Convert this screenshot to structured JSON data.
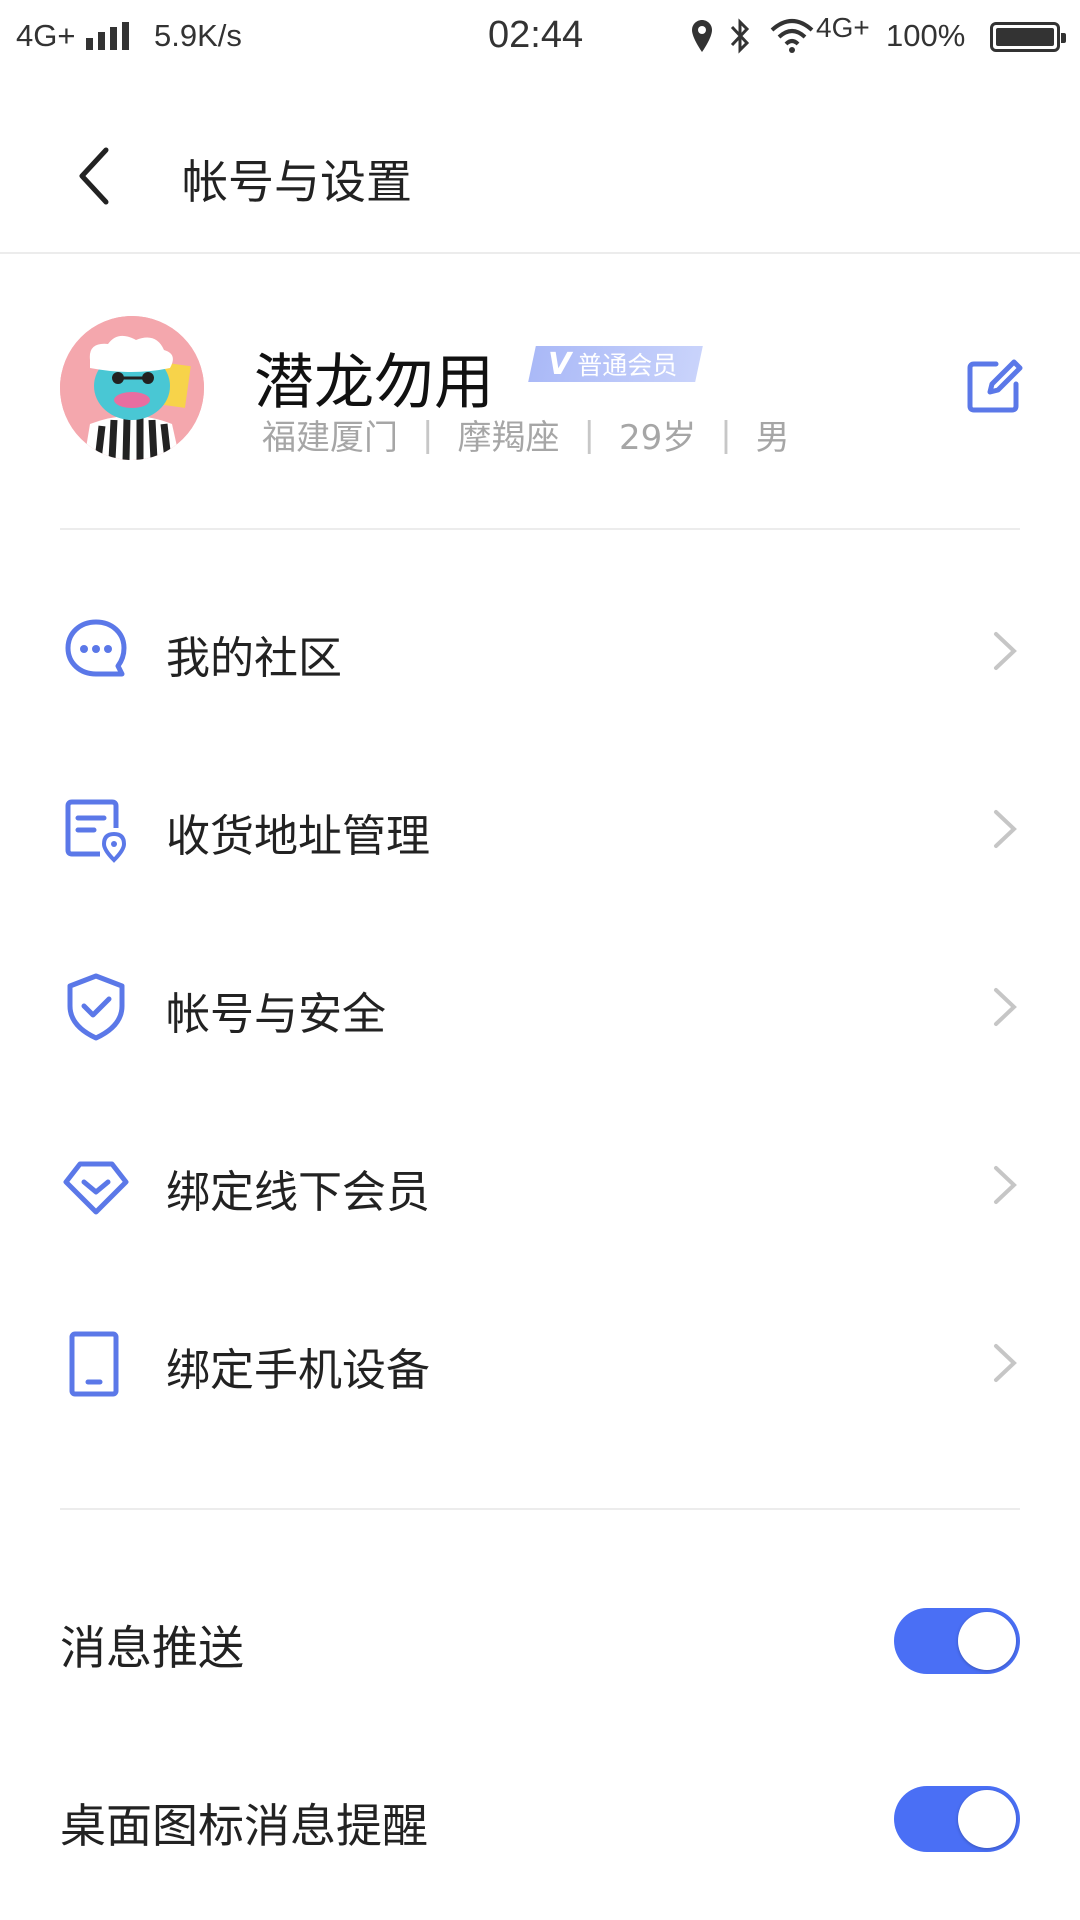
{
  "status_bar": {
    "network_left": "4G+",
    "speed": "5.9K/s",
    "time": "02:44",
    "network_right": "4G+",
    "battery": "100%"
  },
  "header": {
    "title": "帐号与设置"
  },
  "profile": {
    "nickname": "潜龙勿用",
    "badge_mark": "V",
    "badge_label": "普通会员",
    "location": "福建厦门",
    "zodiac": "摩羯座",
    "age": "29岁",
    "gender": "男",
    "separator": "|"
  },
  "menu": {
    "items": [
      {
        "label": "我的社区",
        "icon": "chat-bubble-icon"
      },
      {
        "label": "收货地址管理",
        "icon": "address-card-icon"
      },
      {
        "label": "帐号与安全",
        "icon": "shield-check-icon"
      },
      {
        "label": "绑定线下会员",
        "icon": "diamond-icon"
      },
      {
        "label": "绑定手机设备",
        "icon": "phone-device-icon"
      }
    ]
  },
  "settings": {
    "toggles": [
      {
        "label": "消息推送",
        "on": true
      },
      {
        "label": "桌面图标消息提醒",
        "on": true
      }
    ]
  },
  "colors": {
    "accent": "#4a6ff5",
    "icon": "#5b78e8",
    "badge": "#aab9f7"
  }
}
